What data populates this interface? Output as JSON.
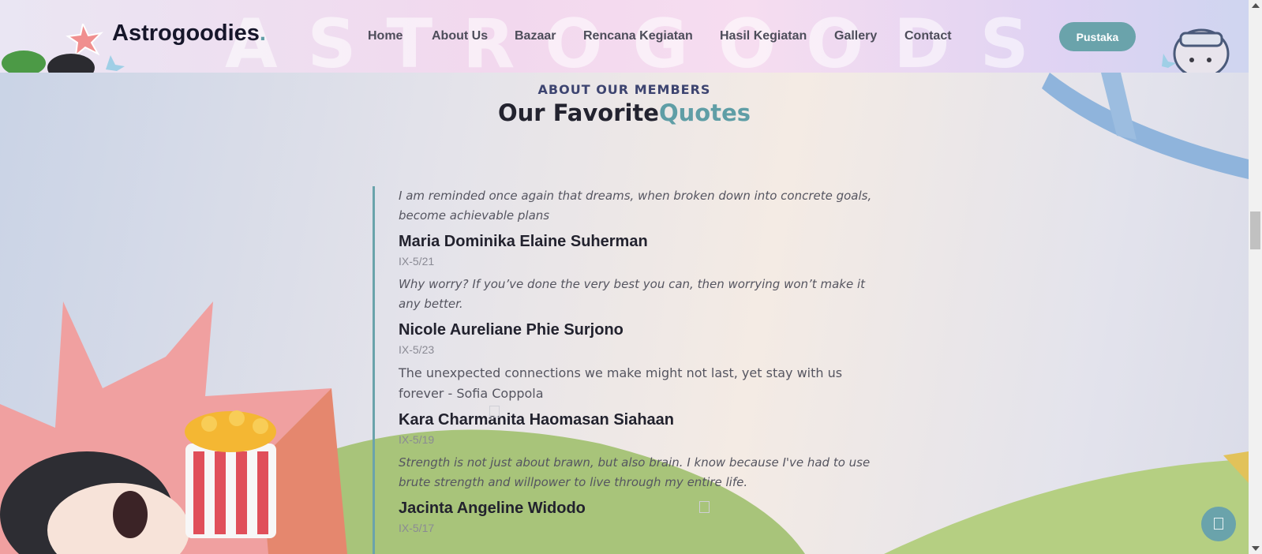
{
  "header": {
    "watermark": "ASTROGOODS",
    "logo": "Astrogoodies",
    "logo_dot": ".",
    "nav": [
      "Home",
      "About Us",
      "Bazaar",
      "Rencana Kegiatan",
      "Hasil Kegiatan",
      "Gallery",
      "Contact"
    ],
    "cta": "Pustaka"
  },
  "section": {
    "eyebrow": "ABOUT OUR MEMBERS",
    "title_main": "Our Favorite",
    "title_accent": "Quotes"
  },
  "quotes": [
    {
      "text": "I am reminded once again that dreams, when broken down into concrete goals, become achievable plans",
      "name": "Maria Dominika Elaine Suherman",
      "class": "IX-5/21"
    },
    {
      "text": "Why worry? If you’ve done the very best you can, then worrying won’t make it any better.",
      "name": "Nicole Aureliane Phie Surjono",
      "class": "IX-5/23"
    },
    {
      "text": "The unexpected connections we make might not last, yet stay with us forever - Sofia Coppola",
      "name": "Kara Charmanita Haomasan Siahaan",
      "class": "IX-5/19"
    },
    {
      "text": "Strength is not just about brawn, but also brain. I know because I've had to use brute strength and willpower to live through my entire life.",
      "name": "Jacinta Angeline Widodo",
      "class": "IX-5/17"
    }
  ],
  "colors": {
    "accent": "#6aa3ab",
    "title_accent": "#5f9ea6",
    "eyebrow": "#3d4470"
  },
  "icons": {
    "float_button": "chat-icon"
  }
}
